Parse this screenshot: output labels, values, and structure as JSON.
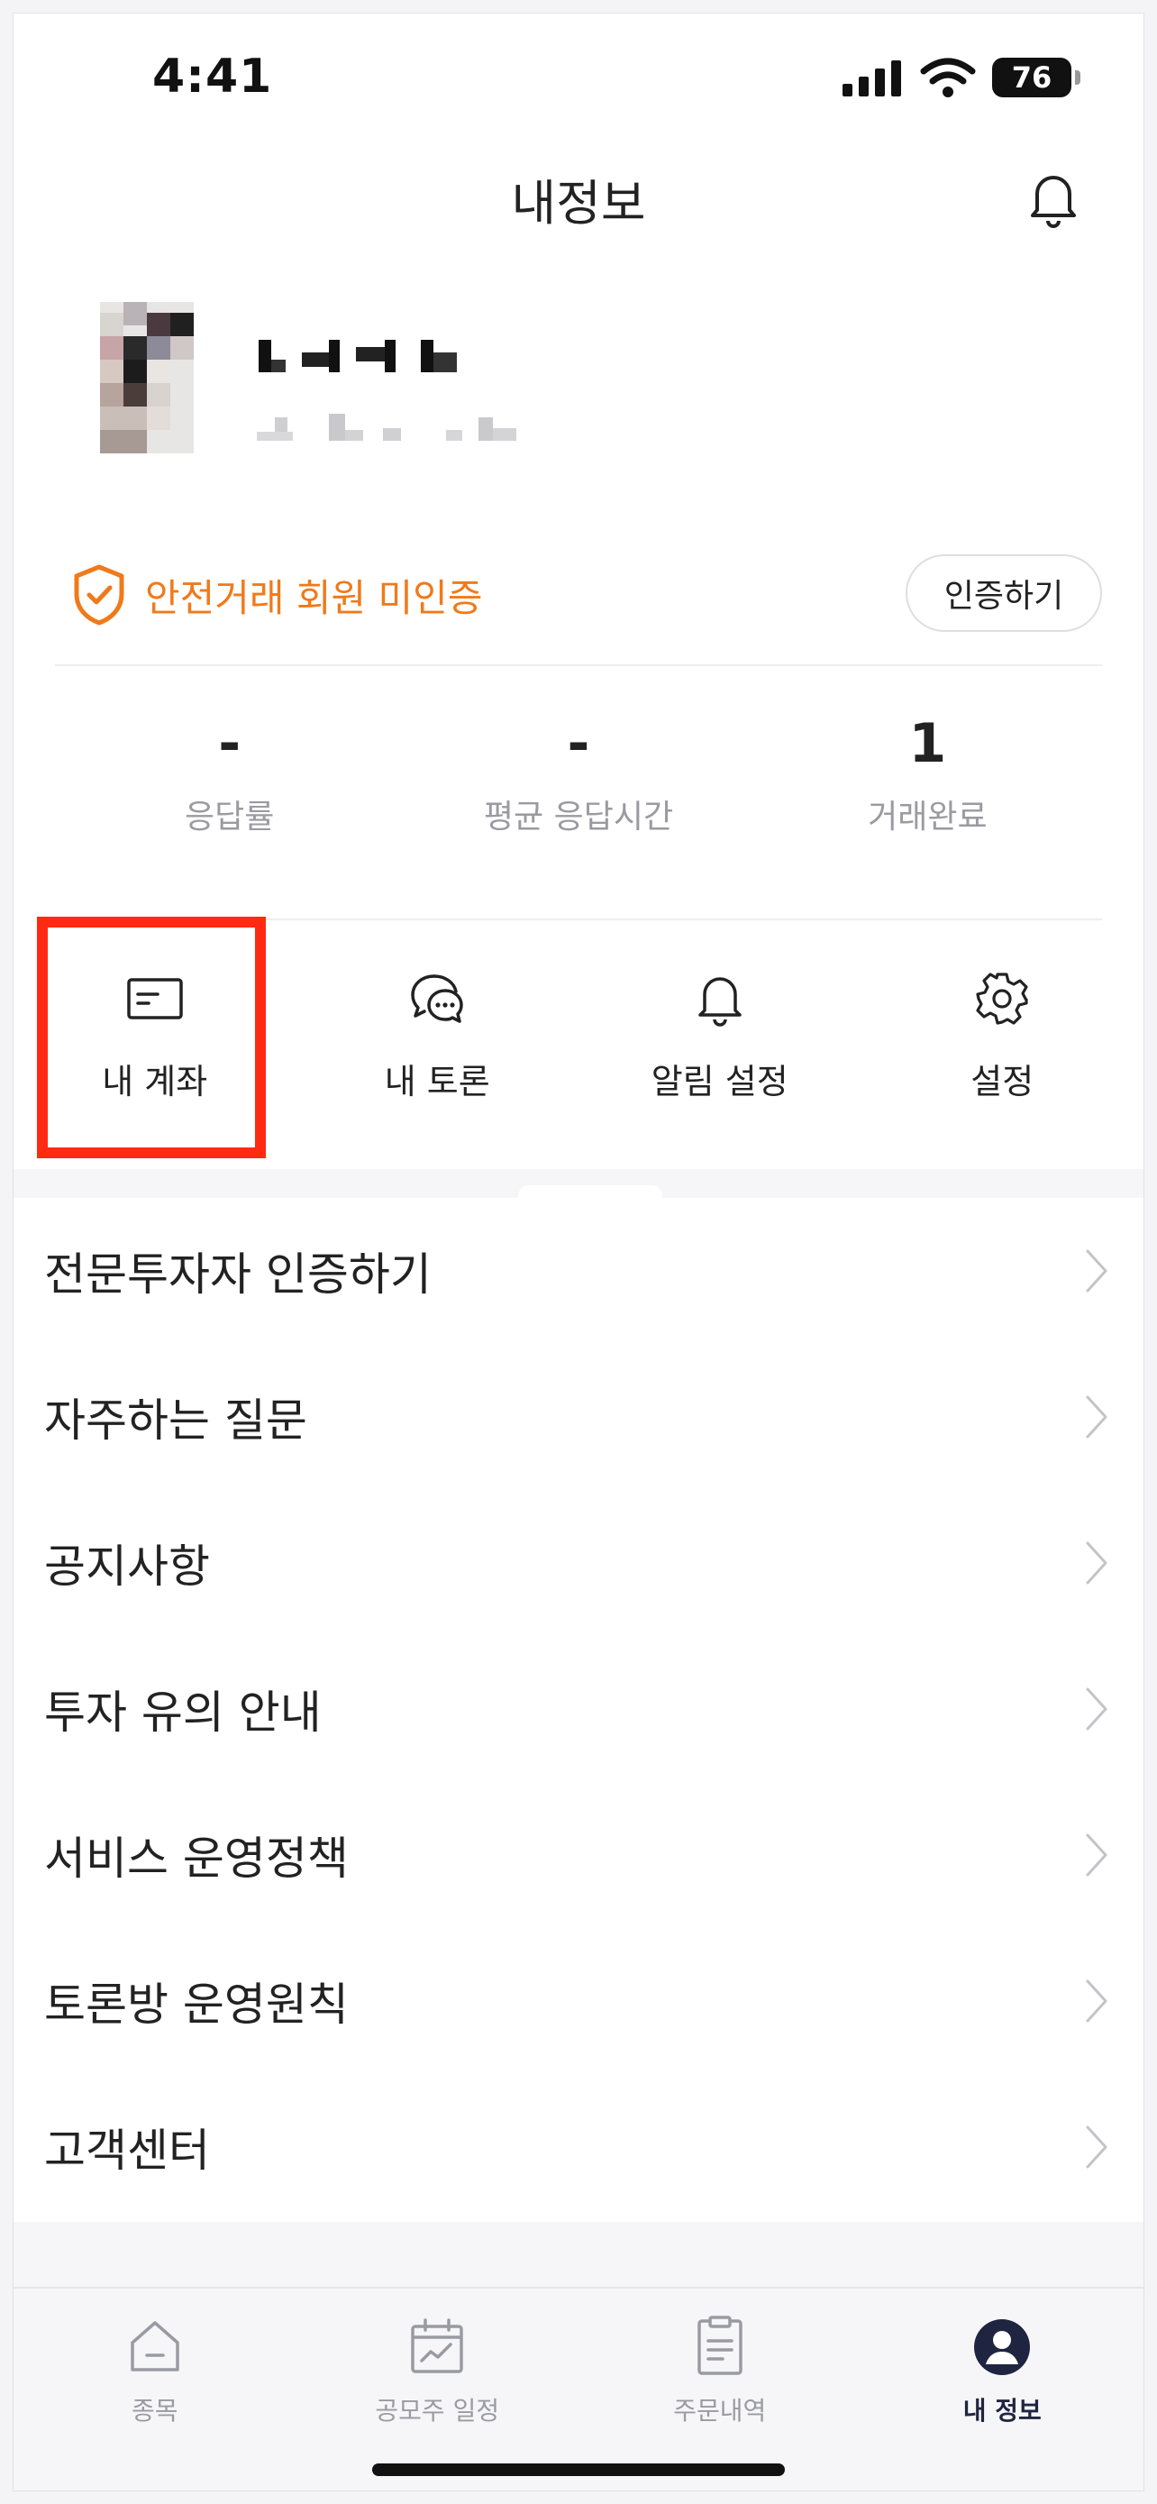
{
  "status_bar": {
    "time": "4:41",
    "battery": "76"
  },
  "header": {
    "title": "내정보"
  },
  "safety": {
    "text": "안전거래 회원 미인증",
    "verify_button": "인증하기",
    "accent_color": "#f07a1a"
  },
  "stats": [
    {
      "value": "-",
      "label": "응답률"
    },
    {
      "value": "-",
      "label": "평균 응답시간"
    },
    {
      "value": "1",
      "label": "거래완료"
    }
  ],
  "quick_menu": [
    {
      "label": "내 계좌",
      "icon": "card-icon"
    },
    {
      "label": "내 토론",
      "icon": "chat-bubbles-icon"
    },
    {
      "label": "알림 설정",
      "icon": "bell-icon"
    },
    {
      "label": "설정",
      "icon": "gear-icon"
    }
  ],
  "menu": [
    "전문투자자 인증하기",
    "자주하는 질문",
    "공지사항",
    "투자 유의 안내",
    "서비스 운영정책",
    "토론방 운영원칙",
    "고객센터"
  ],
  "tabs": [
    {
      "label": "종목",
      "icon": "home-icon",
      "active": false
    },
    {
      "label": "공모주 일정",
      "icon": "calendar-chart-icon",
      "active": false
    },
    {
      "label": "주문내역",
      "icon": "document-icon",
      "active": false
    },
    {
      "label": "내 정보",
      "icon": "profile-icon",
      "active": true
    }
  ],
  "highlight_color": "#ff2a12"
}
